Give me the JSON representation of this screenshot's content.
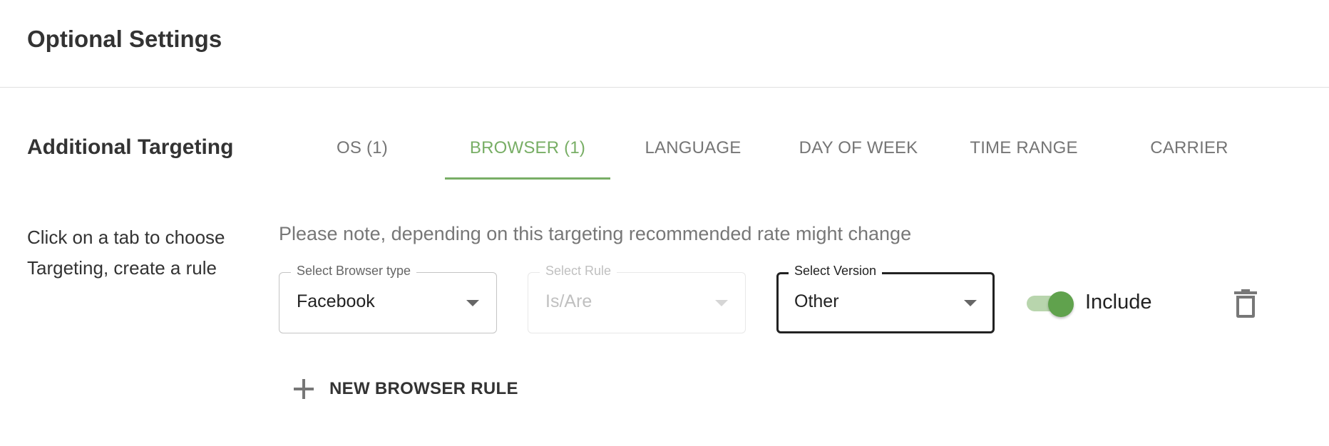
{
  "header": {
    "title": "Optional Settings"
  },
  "targeting": {
    "title": "Additional Targeting",
    "hint": "Click on a tab to choose Targeting, create a rule",
    "note": "Please note, depending on this targeting recommended rate might change",
    "accent_color": "#78ae65",
    "tabs": [
      {
        "label": "OS (1)",
        "active": false
      },
      {
        "label": "BROWSER (1)",
        "active": true
      },
      {
        "label": "LANGUAGE",
        "active": false
      },
      {
        "label": "DAY OF WEEK",
        "active": false
      },
      {
        "label": "TIME RANGE",
        "active": false
      },
      {
        "label": "CARRIER",
        "active": false
      }
    ]
  },
  "rule": {
    "browser_type": {
      "label": "Select Browser type",
      "value": "Facebook"
    },
    "rule": {
      "label": "Select Rule",
      "value": "Is/Are",
      "disabled": true
    },
    "version": {
      "label": "Select Version",
      "value": "Other"
    },
    "include_toggle": {
      "label": "Include",
      "on": true
    },
    "delete_icon": "trash-icon"
  },
  "actions": {
    "new_rule_label": "NEW BROWSER RULE",
    "icon": "plus-icon"
  }
}
